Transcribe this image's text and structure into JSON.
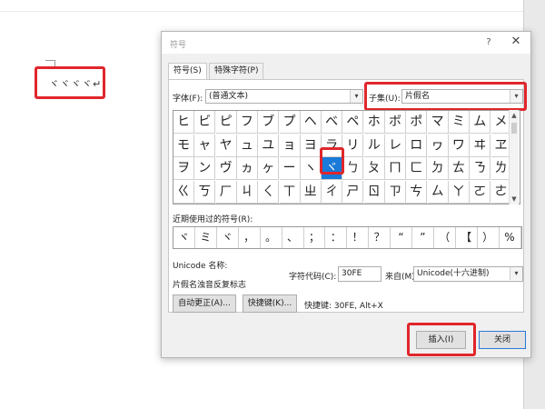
{
  "document": {
    "text": "ヾヾヾヾ↵"
  },
  "dialog": {
    "title": "符号",
    "help": "?",
    "close": "✕",
    "tabs": [
      "符号(S)",
      "特殊字符(P)"
    ],
    "font_label": "字体(F):",
    "font_value": "(普通文本)",
    "subset_label": "子集(U):",
    "subset_value": "片假名",
    "symbol_rows": [
      [
        "ヒ",
        "ビ",
        "ピ",
        "フ",
        "ブ",
        "プ",
        "ヘ",
        "ベ",
        "ペ",
        "ホ",
        "ボ",
        "ポ",
        "マ",
        "ミ",
        "ム",
        "メ"
      ],
      [
        "モ",
        "ャ",
        "ヤ",
        "ュ",
        "ユ",
        "ョ",
        "ヨ",
        "ラ",
        "リ",
        "ル",
        "レ",
        "ロ",
        "ヮ",
        "ワ",
        "ヰ",
        "ヱ"
      ],
      [
        "ヲ",
        "ン",
        "ヴ",
        "ヵ",
        "ヶ",
        "ー",
        "ヽ",
        "ヾ",
        "ㄅ",
        "ㄆ",
        "ㄇ",
        "ㄈ",
        "ㄉ",
        "ㄊ",
        "ㄋ",
        "ㄌ"
      ],
      [
        "ㄍ",
        "ㄎ",
        "ㄏ",
        "ㄐ",
        "ㄑ",
        "ㄒ",
        "ㄓ",
        "ㄔ",
        "ㄕ",
        "ㄖ",
        "ㄗ",
        "ㄘ",
        "ㄙ",
        "ㄚ",
        "ㄛ",
        "ㄜ"
      ]
    ],
    "selected_symbol": "ヾ",
    "recent_label": "近期使用过的符号(R):",
    "recent_symbols": [
      "ヾ",
      "ミ",
      "ヾ",
      "，",
      "。",
      "、",
      "；",
      "：",
      "！",
      "？",
      "“",
      "”",
      "（",
      "【",
      "）",
      "%"
    ],
    "unicode_name_label": "Unicode 名称:",
    "unicode_name_value": "片假名浊音反复标志",
    "char_code_label": "字符代码(C):",
    "char_code_value": "30FE",
    "from_label": "来自(M):",
    "from_value": "Unicode(十六进制)",
    "autocorrect_button": "自动更正(A)...",
    "shortcut_button": "快捷键(K)...",
    "shortcut_text": "快捷键: 30FE, Alt+X",
    "insert_button": "插入(I)",
    "close_button": "关闭"
  },
  "colors": {
    "highlight": "#e0262b",
    "selection": "#1a7ad7"
  }
}
